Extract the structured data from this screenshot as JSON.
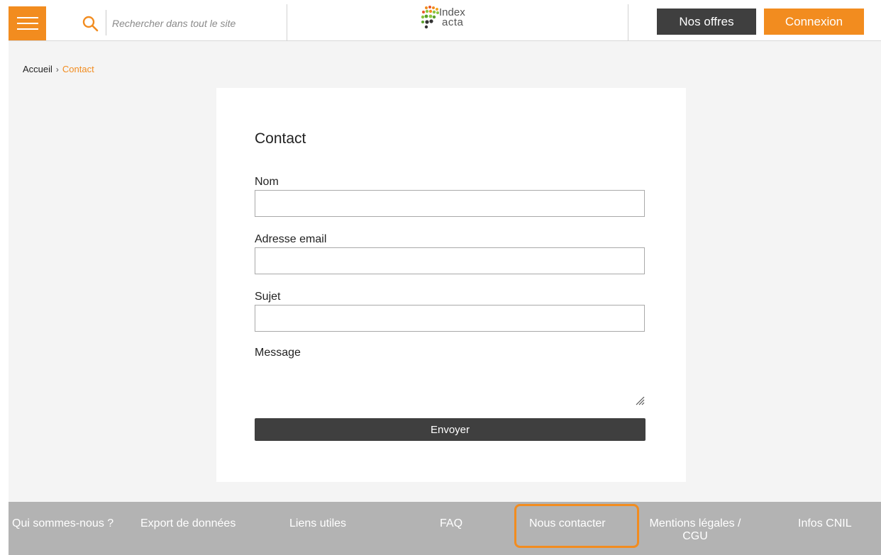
{
  "header": {
    "search_placeholder": "Rechercher dans tout le site",
    "logo_line1": "Index",
    "logo_line2": "acta",
    "offres_label": "Nos offres",
    "connexion_label": "Connexion"
  },
  "breadcrumb": {
    "home": "Accueil",
    "separator": "›",
    "current": "Contact"
  },
  "form": {
    "title": "Contact",
    "name_label": "Nom",
    "email_label": "Adresse email",
    "subject_label": "Sujet",
    "message_label": "Message",
    "submit_label": "Envoyer"
  },
  "footer": {
    "links": [
      "Qui sommes-nous ?",
      "Export de données",
      "Liens utiles",
      "FAQ",
      "Nous contacter",
      "Mentions légales /",
      "CGU",
      "Infos CNIL"
    ]
  },
  "colors": {
    "accent": "#f28c1f",
    "dark_button": "#3f3f3f",
    "footer_bg": "#b3b3b3",
    "page_bg": "#f4f4f4"
  },
  "icons": [
    "menu-icon",
    "search-icon",
    "logo-dots-icon",
    "resize-handle-icon"
  ]
}
